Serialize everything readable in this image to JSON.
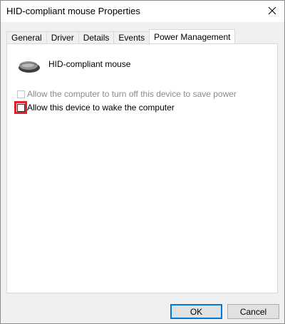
{
  "window": {
    "title": "HID-compliant mouse Properties",
    "close_icon": "×"
  },
  "tabs": [
    {
      "label": "General"
    },
    {
      "label": "Driver"
    },
    {
      "label": "Details"
    },
    {
      "label": "Events"
    },
    {
      "label": "Power Management",
      "active": true
    }
  ],
  "panel": {
    "device_name": "HID-compliant mouse",
    "icon": "mouse-icon",
    "options": [
      {
        "label": "Allow the computer to turn off this device to save power",
        "checked": false,
        "enabled": false
      },
      {
        "label": "Allow this device to wake the computer",
        "checked": false,
        "enabled": true,
        "highlighted": true
      }
    ]
  },
  "buttons": {
    "ok": "OK",
    "cancel": "Cancel"
  },
  "colors": {
    "highlight": "#e0202a",
    "default_button_border": "#0078d7"
  }
}
